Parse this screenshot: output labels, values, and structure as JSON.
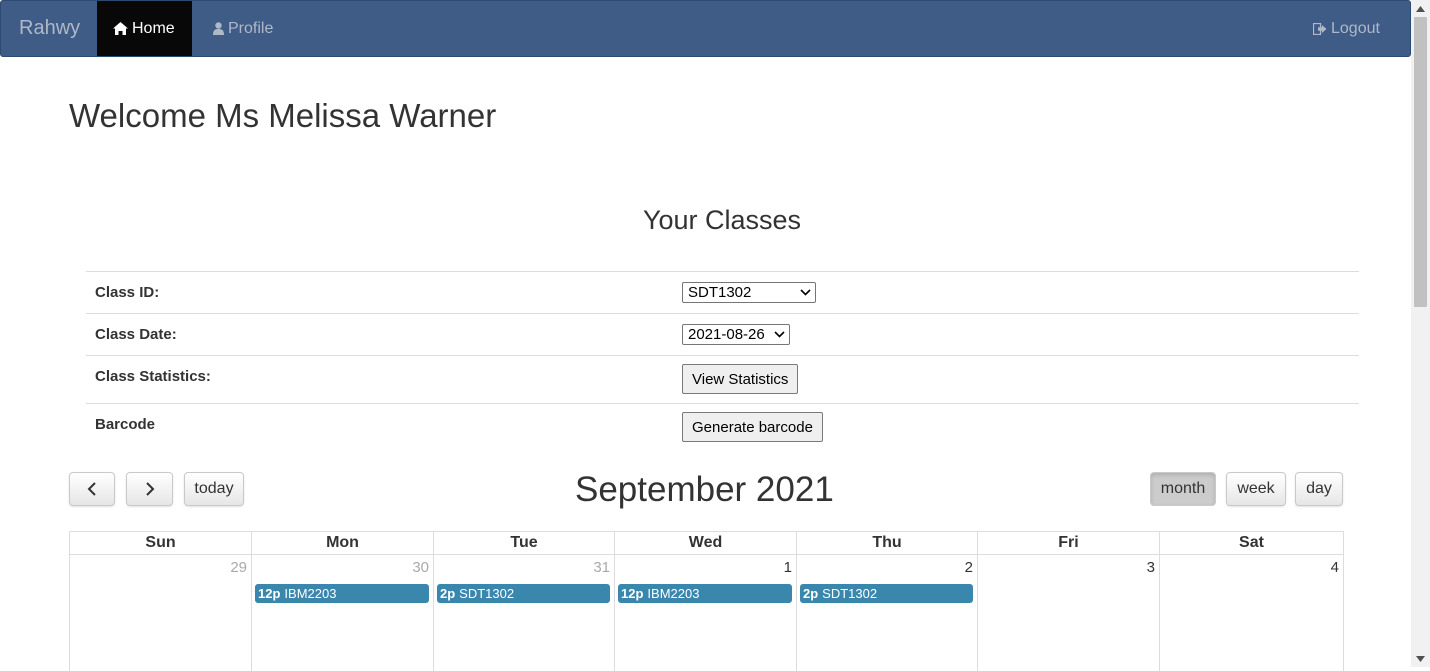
{
  "navbar": {
    "brand": "Rahwy",
    "home_label": "Home",
    "profile_label": "Profile",
    "logout_label": "Logout"
  },
  "page": {
    "welcome": "Welcome Ms Melissa Warner",
    "classes_title": "Your Classes"
  },
  "form": {
    "class_id_label": "Class ID:",
    "class_id_value": "SDT1302",
    "class_date_label": "Class Date:",
    "class_date_value": "2021-08-26",
    "stats_label": "Class Statistics:",
    "stats_button": "View Statistics",
    "barcode_label": "Barcode",
    "barcode_button": "Generate barcode"
  },
  "calendar": {
    "title": "September 2021",
    "today_label": "today",
    "view_month": "month",
    "view_week": "week",
    "view_day": "day",
    "active_view": "month",
    "weekdays": [
      "Sun",
      "Mon",
      "Tue",
      "Wed",
      "Thu",
      "Fri",
      "Sat"
    ],
    "days": [
      {
        "num": "29",
        "other_month": true,
        "event_time": "",
        "event_name": ""
      },
      {
        "num": "30",
        "other_month": true,
        "event_time": "12p",
        "event_name": "IBM2203"
      },
      {
        "num": "31",
        "other_month": true,
        "event_time": "2p",
        "event_name": "SDT1302"
      },
      {
        "num": "1",
        "other_month": false,
        "event_time": "12p",
        "event_name": "IBM2203"
      },
      {
        "num": "2",
        "other_month": false,
        "event_time": "2p",
        "event_name": "SDT1302"
      },
      {
        "num": "3",
        "other_month": false,
        "event_time": "",
        "event_name": ""
      },
      {
        "num": "4",
        "other_month": false,
        "event_time": "",
        "event_name": ""
      }
    ],
    "event_color": "#3a87ad"
  },
  "icons": {
    "home": "home-icon",
    "profile": "user-icon",
    "logout": "logout-icon",
    "prev": "chevron-left-icon",
    "next": "chevron-right-icon"
  }
}
